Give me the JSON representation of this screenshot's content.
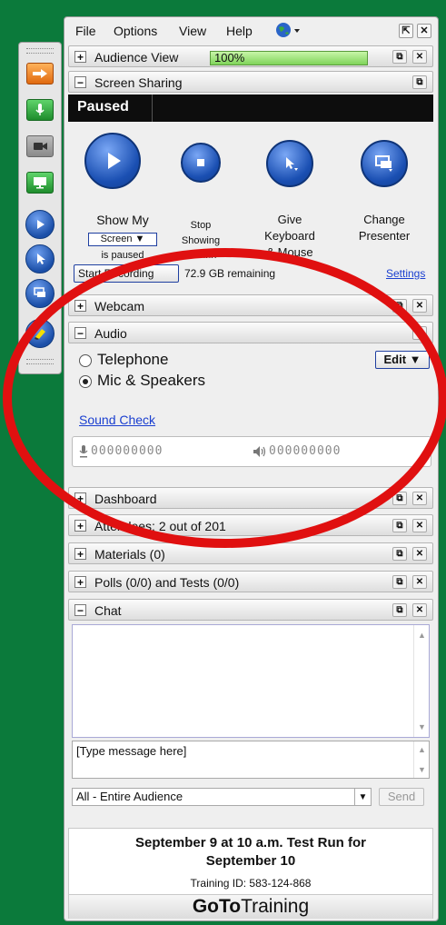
{
  "menu": {
    "file": "File",
    "options": "Options",
    "view": "View",
    "help": "Help"
  },
  "audience_view": {
    "title": "Audience View",
    "zoom": "100%"
  },
  "screen_sharing": {
    "title": "Screen Sharing",
    "status": "Paused",
    "show_my_l1": "Show My",
    "screen_dropdown": "Screen ▼",
    "is_paused": "is paused",
    "stop_l1": "Stop",
    "stop_l2": "Showing",
    "stop_l3": "Screen",
    "give_l1": "Give",
    "give_l2": "Keyboard",
    "give_l3": "& Mouse",
    "change_l1": "Change",
    "change_l2": "Presenter",
    "start_recording": "Start Recording",
    "remaining": "72.9 GB remaining",
    "settings": "Settings"
  },
  "webcam": {
    "title": "Webcam"
  },
  "audio": {
    "title": "Audio",
    "telephone": "Telephone",
    "mic_speakers": "Mic & Speakers",
    "edit": "Edit ▼",
    "sound_check": "Sound Check",
    "mic_meter": "000000000",
    "speaker_meter": "000000000"
  },
  "dashboard": {
    "title": "Dashboard"
  },
  "attendees": {
    "title": "Attendees:  2 out of 201"
  },
  "materials": {
    "title": "Materials (0)"
  },
  "polls": {
    "title": "Polls (0/0) and Tests (0/0)"
  },
  "chat": {
    "title": "Chat",
    "input_placeholder": "[Type message here]",
    "recipient": "All - Entire Audience",
    "send": "Send"
  },
  "footer": {
    "line1": "September 9 at 10 a.m. Test Run for",
    "line2": "September 10",
    "training_id": "Training ID: 583-124-868",
    "brand_bold": "GoTo",
    "brand_light": "Training"
  },
  "colors": {
    "background": "#0b7a3b",
    "accent_blue": "#1a4fb2",
    "annotation_red": "#e01010"
  },
  "icons": [
    "arrow-right-icon",
    "microphone-icon",
    "webcam-icon",
    "monitor-icon",
    "play-icon",
    "pointer-icon",
    "presenter-icon",
    "highlighter-icon",
    "globe-icon",
    "popout-icon",
    "close-icon",
    "restore-icon"
  ]
}
